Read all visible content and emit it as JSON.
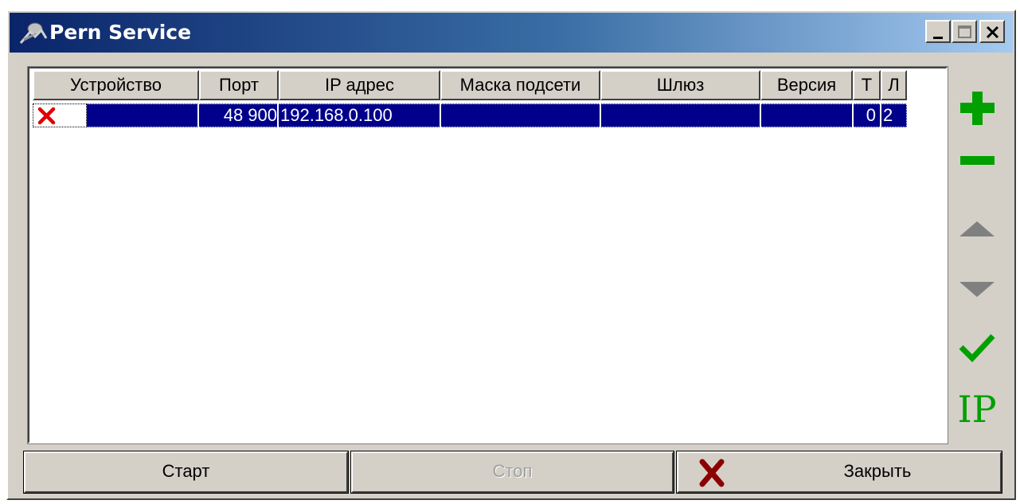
{
  "window": {
    "title": "Pern Service",
    "controls": {
      "minimize": "minimize",
      "maximize": "maximize",
      "close": "close"
    }
  },
  "table": {
    "columns": [
      "Устройство",
      "Порт",
      "IP адрес",
      "Маска подсети",
      "Шлюз",
      "Версия",
      "Т",
      "Л"
    ],
    "rows": [
      {
        "device_status": "error-x-icon",
        "device": "",
        "port": "48 900",
        "ip": "192.168.0.100",
        "mask": "",
        "gateway": "",
        "version": "",
        "t": "0",
        "l": "2"
      }
    ]
  },
  "side_toolbar": {
    "add": "add-icon",
    "remove": "remove-icon",
    "move_up": "arrow-up-icon",
    "move_down": "arrow-down-icon",
    "apply": "check-icon",
    "ip_label": "IP"
  },
  "buttons": {
    "start": "Старт",
    "stop": "Стоп",
    "close": "Закрыть"
  },
  "colors": {
    "selection": "#00008b",
    "accent_green": "#00a000",
    "arrow_gray": "#808080",
    "error_red": "#e00000",
    "close_x_red": "#8b0000"
  }
}
